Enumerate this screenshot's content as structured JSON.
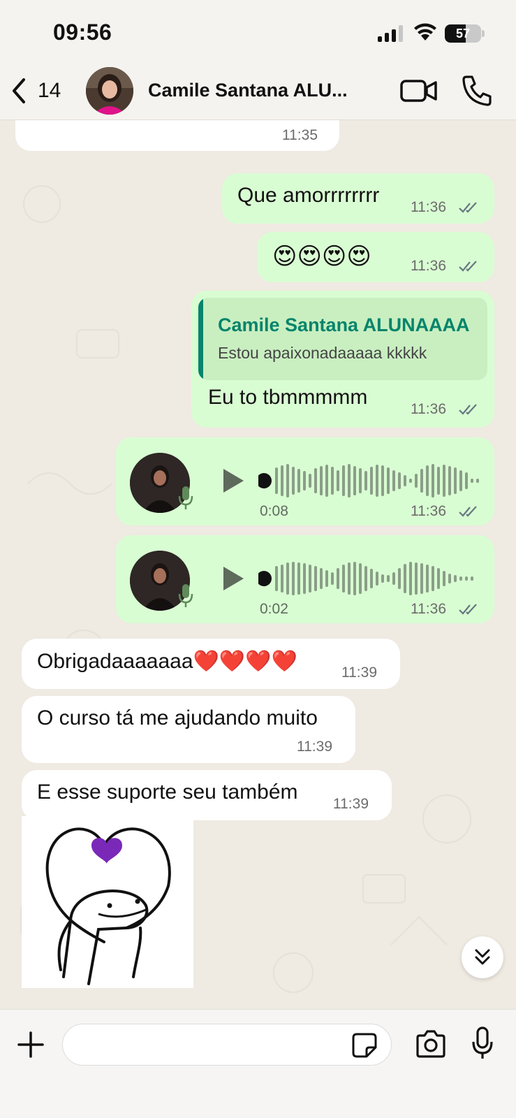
{
  "status_bar": {
    "time": "09:56",
    "battery": "57",
    "battery_level": 0.57
  },
  "header": {
    "back_count": "14",
    "contact_name": "Camile Santana ALU..."
  },
  "messages": {
    "top_partial": {
      "time": "11:35"
    },
    "m1": {
      "text": "Que amorrrrrrrr",
      "time": "11:36"
    },
    "m2": {
      "text": "😍😍😍😍",
      "time": "11:36"
    },
    "m3": {
      "quote_name": "Camile Santana ALUNAAAA",
      "quote_text": "Estou apaixonadaaaaa kkkkk",
      "text": "Eu to tbmmmmm",
      "time": "11:36"
    },
    "voice1": {
      "duration": "0:08",
      "time": "11:36"
    },
    "voice2": {
      "duration": "0:02",
      "time": "11:36"
    },
    "m4": {
      "text": "Obrigadaaaaaaa❤️❤️❤️❤️",
      "time": "11:39"
    },
    "m5": {
      "text": "O curso tá me ajudando muito",
      "time": "11:39"
    },
    "m6": {
      "text": "E esse suporte seu também",
      "time": "11:39"
    }
  },
  "composer": {
    "placeholder": ""
  },
  "colors": {
    "outgoing": "#d9fdd3",
    "incoming": "#ffffff",
    "accent": "#06846b",
    "background": "#efeae2"
  },
  "icons": [
    "back-chevron-icon",
    "video-call-icon",
    "phone-icon",
    "double-check-icon",
    "play-icon",
    "mic-icon",
    "scroll-down-icon",
    "plus-icon",
    "sticker-icon",
    "camera-icon"
  ]
}
